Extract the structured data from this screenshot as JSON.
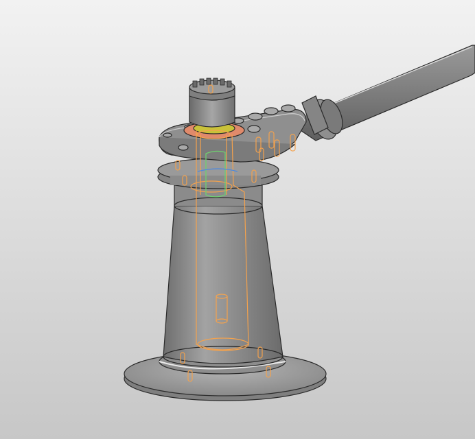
{
  "viewport": {
    "background_top": "#f2f2f2",
    "background_bottom": "#c7c7c7"
  },
  "model": {
    "body_color": "#8e8e8e",
    "edge_color": "#2a2a2a",
    "hidden_parts_color": "#f4a24d",
    "gasket_color": "#e08a6b",
    "ring_color": "#c9c23a",
    "highlight_green": "#6fd06f",
    "highlight_blue": "#4b88e0",
    "parts": [
      "base-flange",
      "conical-body",
      "top-flange",
      "upper-flange",
      "splined-shaft",
      "lever-handle",
      "bolts",
      "hidden-pins",
      "hidden-cylinder"
    ]
  }
}
